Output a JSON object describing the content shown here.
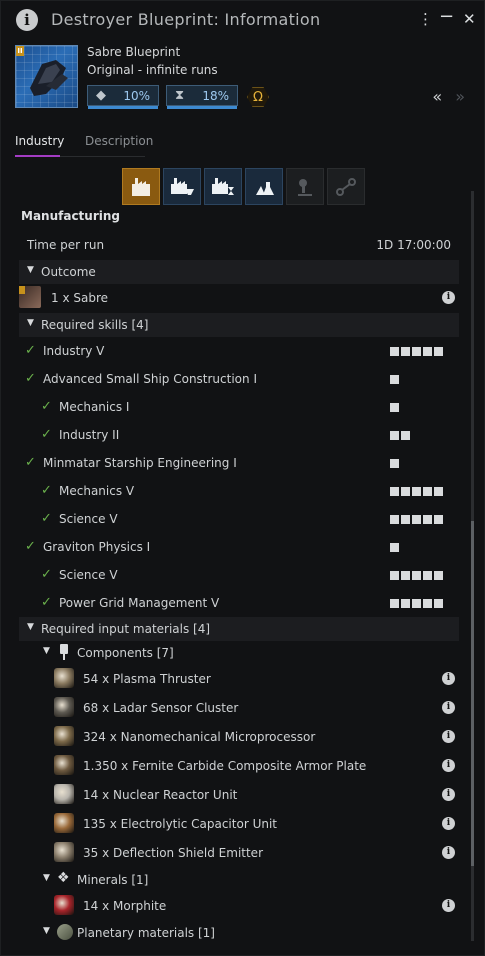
{
  "window": {
    "title": "Destroyer Blueprint: Information",
    "info_icon": "info-icon",
    "controls": [
      "more-icon",
      "minimize-icon",
      "close-icon"
    ]
  },
  "header": {
    "name": "Sabre Blueprint",
    "runs": "Original - infinite runs",
    "material_efficiency": "10%",
    "material_efficiency_fill": 1.0,
    "time_efficiency": "18%",
    "time_efficiency_fill": 1.0,
    "omega_symbol": "Ω",
    "accent_color": "#3d8ad1",
    "omega_color": "#e7b33a"
  },
  "tabs": [
    {
      "label": "Industry",
      "active": true
    },
    {
      "label": "Description",
      "active": false
    }
  ],
  "activities": [
    {
      "name": "manufacturing-icon",
      "active": true,
      "enabled": true
    },
    {
      "name": "research-material-icon",
      "active": false,
      "enabled": true
    },
    {
      "name": "research-time-icon",
      "active": false,
      "enabled": true
    },
    {
      "name": "copying-icon",
      "active": false,
      "enabled": true
    },
    {
      "name": "invention-icon",
      "active": false,
      "enabled": false
    },
    {
      "name": "reaction-icon",
      "active": false,
      "enabled": false
    }
  ],
  "section": {
    "title": "Manufacturing",
    "time_label": "Time per run",
    "time_value": "1D 17:00:00"
  },
  "outcome": {
    "label": "Outcome",
    "item": "1 x Sabre"
  },
  "skills": {
    "label": "Required skills [4]",
    "items": [
      {
        "name": "Industry V",
        "level": 5,
        "depth": 0
      },
      {
        "name": "Advanced Small Ship Construction I",
        "level": 1,
        "depth": 0
      },
      {
        "name": "Mechanics I",
        "level": 1,
        "depth": 1
      },
      {
        "name": "Industry II",
        "level": 2,
        "depth": 1
      },
      {
        "name": "Minmatar Starship Engineering I",
        "level": 1,
        "depth": 0
      },
      {
        "name": "Mechanics V",
        "level": 5,
        "depth": 1
      },
      {
        "name": "Science V",
        "level": 5,
        "depth": 1
      },
      {
        "name": "Graviton Physics I",
        "level": 1,
        "depth": 0
      },
      {
        "name": "Science V",
        "level": 5,
        "depth": 1
      },
      {
        "name": "Power Grid Management V",
        "level": 5,
        "depth": 1
      }
    ]
  },
  "materials": {
    "label": "Required input materials [4]",
    "components_label": "Components [7]",
    "components": [
      {
        "text": "54 x Plasma Thruster",
        "icon": "plasma-thruster-icon",
        "color": "#8a7a60"
      },
      {
        "text": "68 x Ladar Sensor Cluster",
        "icon": "sensor-cluster-icon",
        "color": "#5e5a52"
      },
      {
        "text": "324 x Nanomechanical Microprocessor",
        "icon": "microprocessor-icon",
        "color": "#7d6a4a"
      },
      {
        "text": "1.350 x Fernite Carbide Composite Armor Plate",
        "icon": "armor-plate-icon",
        "color": "#6e5a40"
      },
      {
        "text": "14 x Nuclear Reactor Unit",
        "icon": "reactor-icon",
        "color": "#b8b4ac"
      },
      {
        "text": "135 x Electrolytic Capacitor Unit",
        "icon": "capacitor-icon",
        "color": "#9a6a3a"
      },
      {
        "text": "35 x Deflection Shield Emitter",
        "icon": "shield-emitter-icon",
        "color": "#8a7e6c"
      }
    ],
    "minerals_label": "Minerals [1]",
    "minerals": [
      {
        "text": "14 x Morphite",
        "icon": "morphite-icon",
        "color": "#a8242a"
      }
    ],
    "planetary_label": "Planetary materials [1]"
  }
}
